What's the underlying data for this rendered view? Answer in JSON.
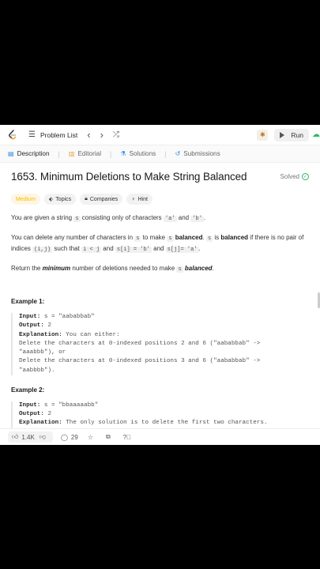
{
  "topbar": {
    "problem_list": "Problem List",
    "run": "Run"
  },
  "tabs": [
    {
      "label": "Description"
    },
    {
      "label": "Editorial"
    },
    {
      "label": "Solutions"
    },
    {
      "label": "Submissions"
    }
  ],
  "problem": {
    "title": "1653. Minimum Deletions to Make String Balanced",
    "status": "Solved",
    "tags": {
      "difficulty": "Medium",
      "topics": "Topics",
      "companies": "Companies",
      "hint": "Hint"
    },
    "p1": {
      "a": "You are given a string ",
      "code1": "s",
      "b": " consisting only of characters ",
      "code2": "'a'",
      "c": " and ",
      "code3": "'b'",
      "d": "."
    },
    "p2": {
      "a": "You can delete any number of characters in ",
      "code1": "s",
      "b": " to make ",
      "code2": "s",
      "bold1": "balanced",
      "c": ". ",
      "code3": "s",
      "d": " is ",
      "bold2": "balanced",
      "e": " if there is no pair of indices ",
      "code4": "(i,j)",
      "f": " such that ",
      "code5": "i < j",
      "g": " and ",
      "code6": "s[i] = 'b'",
      "h": " and ",
      "code7": "s[j]= 'a'",
      "i": "."
    },
    "p3": {
      "a": "Return the ",
      "bold1": "minimum",
      "b": " number of deletions needed to make ",
      "code1": "s",
      "bold2": "balanced",
      "c": "."
    },
    "example1": {
      "title": "Example 1:",
      "input_label": "Input:",
      "input_value": " s = \"aababbab\"",
      "output_label": "Output:",
      "output_value": " 2",
      "explanation_label": "Explanation:",
      "explanation_value": " You can either:",
      "line1": "Delete the characters at 0-indexed positions 2 and 6 (\"aababbab\" ->",
      "line2": "\"aaabbb\"), or",
      "line3": "Delete the characters at 0-indexed positions 3 and 6 (\"aababbab\" ->",
      "line4": "\"aabbbb\")."
    },
    "example2": {
      "title": "Example 2:",
      "input_label": "Input:",
      "input_value": " s = \"bbaaaaabb\"",
      "output_label": "Output:",
      "output_value": " 2",
      "explanation_label": "Explanation:",
      "explanation_value": " The only solution is to delete the first two characters."
    }
  },
  "bottombar": {
    "likes": "1.4K",
    "comments": "29"
  },
  "colors": {
    "accent_green": "#2cbb5d",
    "medium": "#ffb800",
    "logo": "#f89f1b"
  }
}
